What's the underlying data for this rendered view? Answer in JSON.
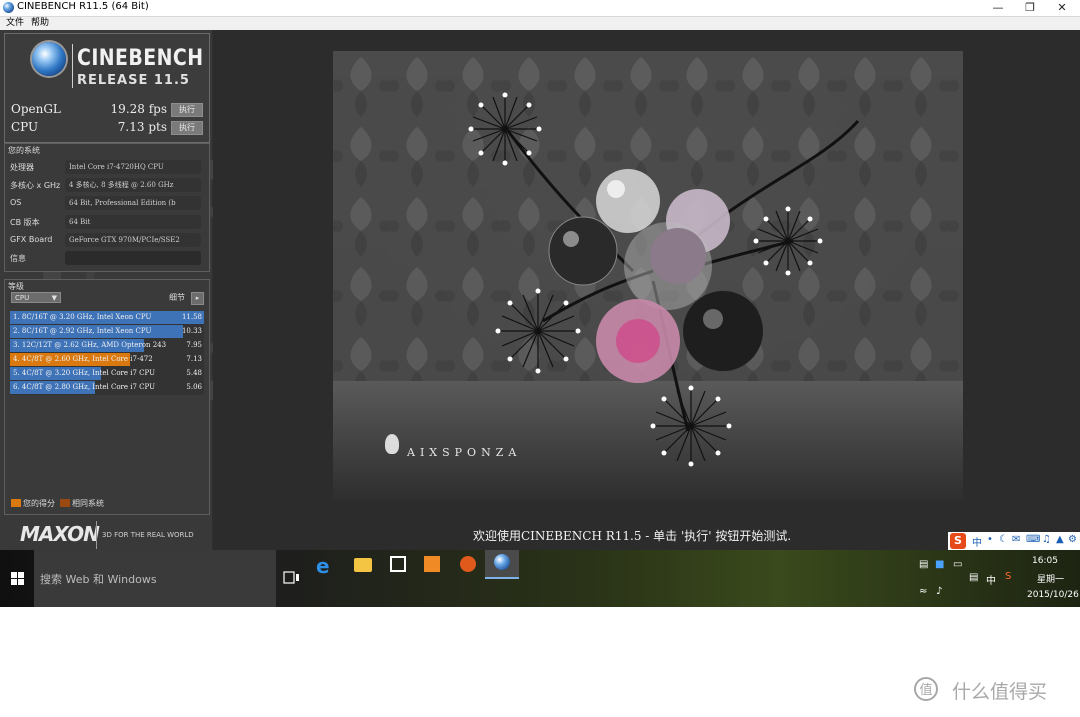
{
  "window": {
    "title": "CINEBENCH R11.5 (64 Bit)"
  },
  "menu": {
    "items": [
      "文件",
      "帮助"
    ]
  },
  "logo": {
    "title": "CINEBENCH",
    "release": "RELEASE 11.5"
  },
  "scores": [
    {
      "label": "OpenGL",
      "value": "19.28 fps",
      "button": "执行"
    },
    {
      "label": "CPU",
      "value": "7.13 pts",
      "button": "执行"
    }
  ],
  "system": {
    "title": "您的系统",
    "rows": [
      {
        "key": "处理器",
        "value": "Intel Core i7-4720HQ CPU"
      },
      {
        "key": "多核心 x GHz",
        "value": "4 多核心, 8 多线程 @ 2.60 GHz"
      },
      {
        "key": "OS",
        "value": "64 Bit, Professional Edition (b"
      },
      {
        "key": "CB 版本",
        "value": "64 Bit"
      },
      {
        "key": "GFX Board",
        "value": "GeForce GTX 970M/PCIe/SSE2"
      },
      {
        "key": "信息",
        "value": ""
      }
    ]
  },
  "ranking": {
    "title": "等级",
    "dropdown": "CPU",
    "details_label": "细节",
    "entries": [
      {
        "name": "1. 8C/16T @ 3.20 GHz, Intel Xeon CPU",
        "score": "11.58",
        "fill": 1.0,
        "color": "#3f73b8"
      },
      {
        "name": "2. 8C/16T @ 2.92 GHz, Intel Xeon CPU",
        "score": "10.33",
        "fill": 0.89,
        "color": "#3f73b8"
      },
      {
        "name": "3. 12C/12T @ 2.62 GHz, AMD Opteron 243",
        "score": "7.95",
        "fill": 0.69,
        "color": "#3f73b8"
      },
      {
        "name": "4. 4C/8T @ 2.60 GHz, Intel Core i7-472",
        "score": "7.13",
        "fill": 0.62,
        "color": "#d9790f"
      },
      {
        "name": "5. 4C/8T @ 3.20 GHz, Intel Core i7 CPU",
        "score": "5.48",
        "fill": 0.47,
        "color": "#3f73b8"
      },
      {
        "name": "6. 4C/8T @ 2.80 GHz, Intel Core i7 CPU",
        "score": "5.06",
        "fill": 0.44,
        "color": "#3f73b8"
      }
    ],
    "legend": [
      {
        "label": "您的得分",
        "color": "#d9790f"
      },
      {
        "label": "相同系统",
        "color": "#9a4a10"
      }
    ]
  },
  "branding": {
    "maxon": "MAXON",
    "tagline": "3D FOR THE REAL WORLD"
  },
  "render": {
    "brand": "AIXSPONZA"
  },
  "status": "欢迎使用CINEBENCH R11.5 - 单击 '执行' 按钮开始测试.",
  "taskbar": {
    "search_placeholder": "搜索 Web 和 Windows",
    "time": "16:05",
    "day": "星期一",
    "date": "2015/10/26",
    "ime_lang": "中"
  },
  "watermark": {
    "text": "什么值得买",
    "logo": "值"
  }
}
